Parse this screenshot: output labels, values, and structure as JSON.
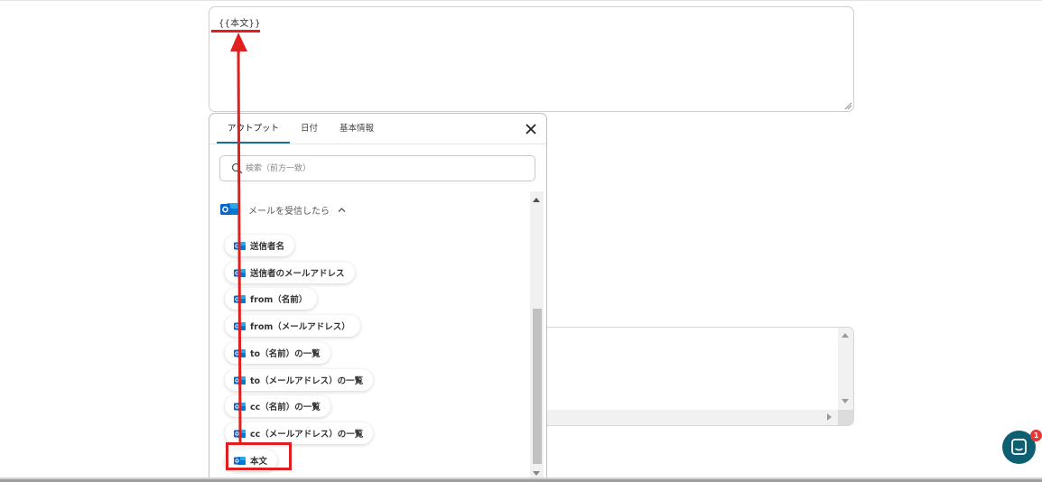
{
  "main_textarea": {
    "value": "{{本文}}"
  },
  "popup": {
    "tabs": [
      {
        "label": "アウトプット",
        "active": true
      },
      {
        "label": "日付",
        "active": false
      },
      {
        "label": "基本情報",
        "active": false
      }
    ],
    "search_placeholder": "検索（前方一致）",
    "section_title": "メールを受信したら",
    "items": [
      {
        "label": "送信者名"
      },
      {
        "label": "送信者のメールアドレス"
      },
      {
        "label": "from（名前）"
      },
      {
        "label": "from（メールアドレス）"
      },
      {
        "label": "to（名前）の一覧"
      },
      {
        "label": "to（メールアドレス）の一覧"
      },
      {
        "label": "cc（名前）の一覧"
      },
      {
        "label": "cc（メールアドレス）の一覧"
      },
      {
        "label": "本文"
      }
    ]
  },
  "chat": {
    "badge": "1"
  },
  "icons": {
    "close": "close-icon",
    "search": "search-icon",
    "app": "outlook-icon",
    "chevron": "chevron-up-icon",
    "chat": "chat-icon"
  },
  "colors": {
    "accent_teal": "#1f6f8b",
    "annotation_red": "#e02020",
    "outlook_blue": "#0a64c8",
    "chat_bg": "#0f5f73",
    "badge_red": "#e53935"
  }
}
